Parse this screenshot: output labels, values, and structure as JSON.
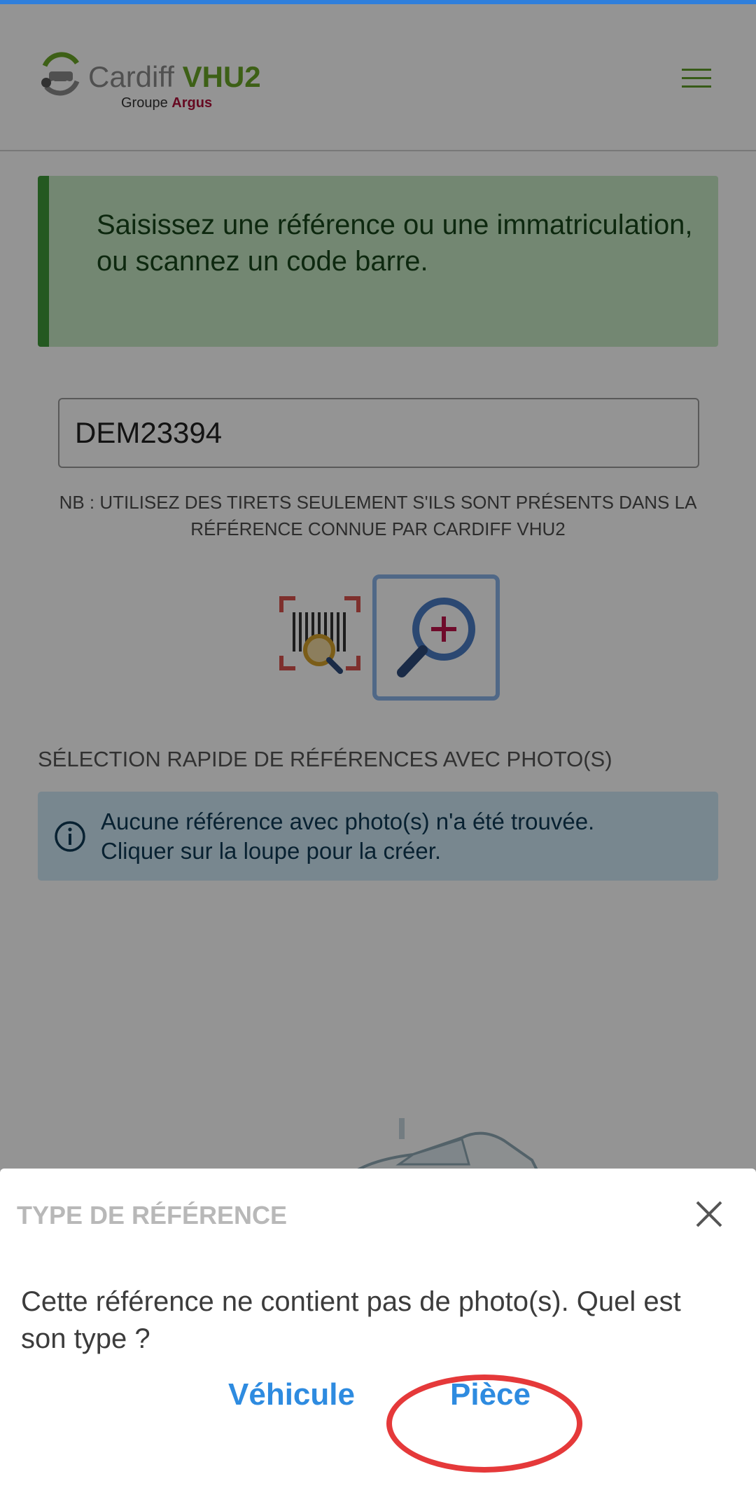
{
  "header": {
    "brand_name": "Cardiff",
    "brand_product": "VHU2",
    "brand_sub_prefix": "Groupe",
    "brand_sub_name": "Argus",
    "icons": {
      "logo": "recycle-car-logo-icon",
      "menu": "hamburger-menu-icon"
    }
  },
  "instruction": {
    "text": "Saisissez une référence ou une immatriculation, ou scannez un code barre."
  },
  "search": {
    "value": "DEM23394",
    "note": "NB : utilisez des tirets seulement s'ils sont présents dans la référence connue par Cardiff VHU2"
  },
  "actions": {
    "icons": {
      "scan": "barcode-scan-icon",
      "search": "magnifier-plus-icon"
    }
  },
  "quick_selection": {
    "title": "Sélection rapide de références avec photo(s)",
    "empty_line1": "Aucune référence avec photo(s) n'a été trouvée.",
    "empty_line2": "Cliquer sur la loupe pour la créer."
  },
  "dialog": {
    "title": "Type de référence",
    "message": "Cette référence ne contient pas de photo(s). Quel est son type ?",
    "option_vehicle": "Véhicule",
    "option_piece": "Pièce",
    "icons": {
      "close": "close-icon"
    }
  },
  "colors": {
    "accent_blue": "#2e8be0",
    "brand_green": "#6aa527",
    "brand_red": "#b0103a",
    "alert_green_bg": "#c7e8c4",
    "alert_blue_bg": "#cfe9f6",
    "highlight_red": "#e5393a"
  }
}
